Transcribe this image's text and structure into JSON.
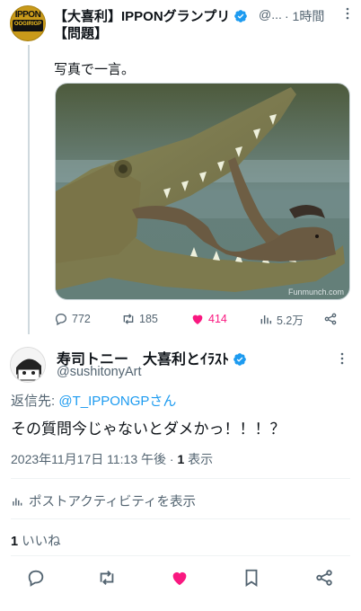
{
  "parent": {
    "avatar_top": "IPPON",
    "avatar_bottom": "OOGIRIGP",
    "name": "【大喜利】IPPONグランプリ",
    "name_line2": "【問題】",
    "handle": "@...",
    "time": "· 1時間",
    "text": "写真で一言。",
    "photo_credit": "Funmunch.com",
    "stats": {
      "replies": "772",
      "reposts": "185",
      "likes": "414",
      "views": "5.2万"
    }
  },
  "reply": {
    "name": "寿司トニー　大喜利とｲﾗｽﾄ",
    "handle": "@sushitonyArt",
    "replying_label": "返信先: ",
    "replying_to": "@T_IPPONGPさん",
    "text": "その質問今じゃないとダメかっ！！！？",
    "timestamp": "2023年11月17日 11:13 午後 · ",
    "view_count": "1",
    "view_label": " 表示",
    "activity_label": "ポストアクティビティを表示",
    "like_count": "1",
    "like_label": " いいね"
  },
  "colors": {
    "accent": "#1d9bf0",
    "like": "#f91880",
    "muted": "#536471"
  },
  "icons": [
    "more-icon",
    "verified-icon",
    "reply-icon",
    "repost-icon",
    "heart-icon",
    "views-icon",
    "share-icon",
    "bookmark-icon",
    "activity-icon"
  ]
}
